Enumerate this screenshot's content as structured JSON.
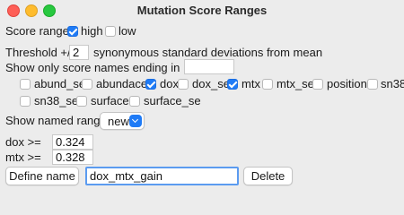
{
  "window": {
    "title": "Mutation Score Ranges"
  },
  "score_ranges": {
    "label": "Score ranges",
    "options": [
      {
        "label": "high",
        "checked": true
      },
      {
        "label": "low",
        "checked": false
      }
    ]
  },
  "threshold": {
    "label": "Threshold +/-",
    "value": "2",
    "suffix": "synonymous standard deviations from mean"
  },
  "suffix_filter": {
    "label": "Show only score names ending in",
    "value": ""
  },
  "score_names": [
    {
      "label": "abund_se",
      "checked": false
    },
    {
      "label": "abundace",
      "checked": false
    },
    {
      "label": "dox",
      "checked": true
    },
    {
      "label": "dox_se",
      "checked": false
    },
    {
      "label": "mtx",
      "checked": true
    },
    {
      "label": "mtx_se",
      "checked": false
    },
    {
      "label": "position",
      "checked": false
    },
    {
      "label": "sn38",
      "checked": false
    },
    {
      "label": "sn38_se",
      "checked": false
    },
    {
      "label": "surface",
      "checked": false
    },
    {
      "label": "surface_se",
      "checked": false
    }
  ],
  "named_ranges": {
    "label": "Show named ranges",
    "selected": "new"
  },
  "ranges": [
    {
      "label": "dox  >=",
      "value": "0.324"
    },
    {
      "label": "mtx  >=",
      "value": "0.328"
    }
  ],
  "footer": {
    "define_label": "Define name",
    "name_value": "dox_mtx_gain",
    "delete_label": "Delete"
  },
  "colors": {
    "accent": "#1f7bf6",
    "window_bg": "#ececec",
    "close": "#fe5f57",
    "minimize": "#febc2e",
    "zoom": "#28c840"
  }
}
